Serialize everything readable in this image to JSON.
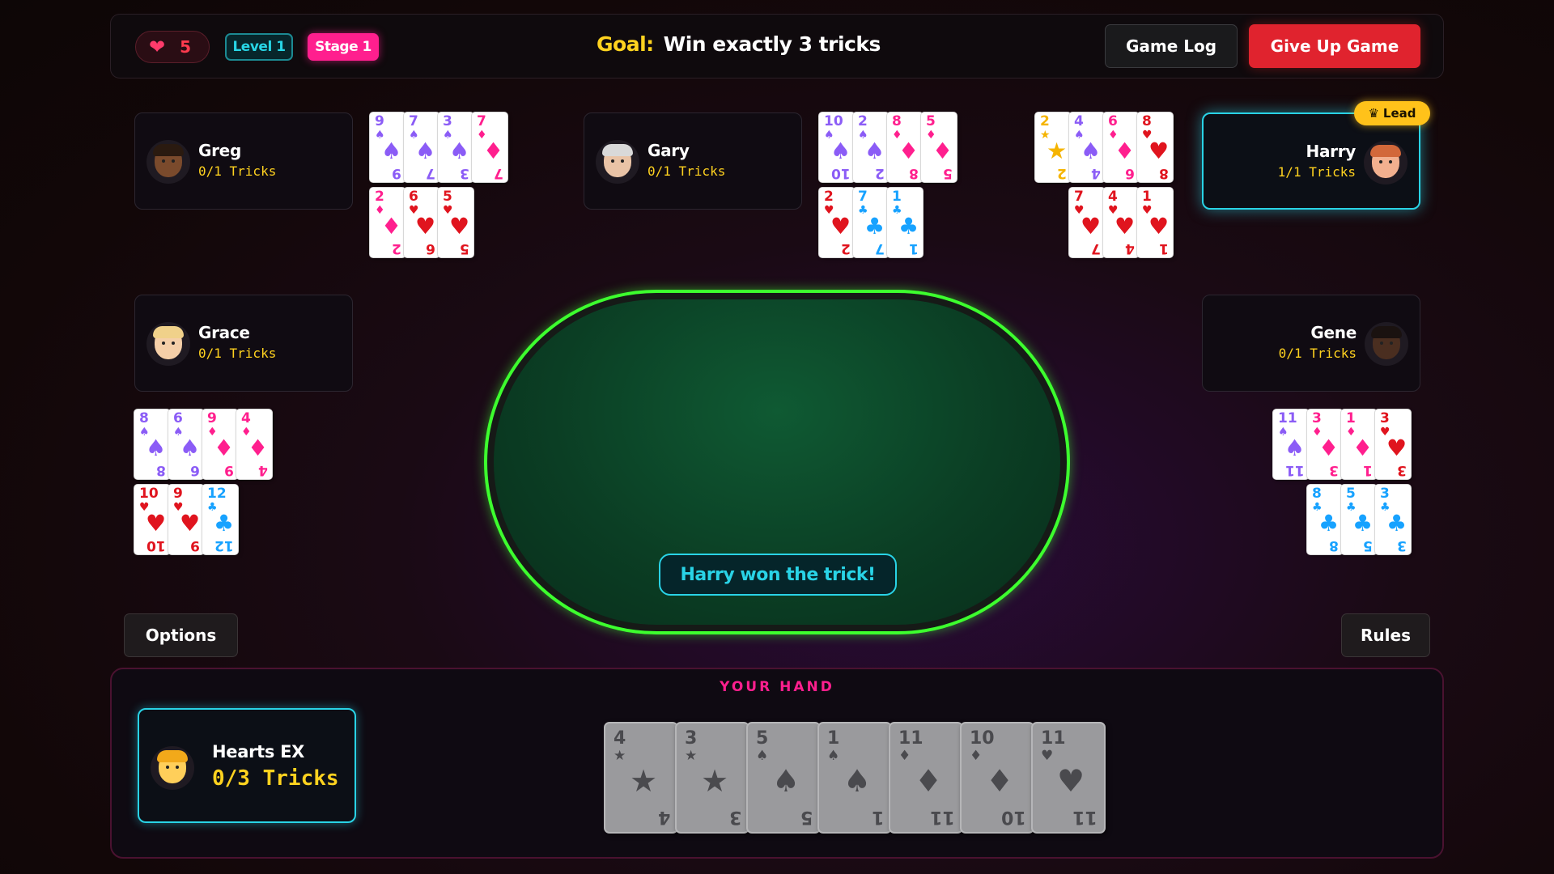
{
  "header": {
    "lives": "5",
    "level": "Level 1",
    "stage": "Stage 1",
    "goal_label": "Goal:",
    "goal_text": "Win exactly 3 tricks",
    "game_log_label": "Game Log",
    "give_up_label": "Give Up Game"
  },
  "players": {
    "greg": {
      "name": "Greg",
      "tricks": "0/1 Tricks"
    },
    "gary": {
      "name": "Gary",
      "tricks": "0/1 Tricks"
    },
    "harry": {
      "name": "Harry",
      "tricks": "1/1 Tricks",
      "badge": "Lead"
    },
    "grace": {
      "name": "Grace",
      "tricks": "0/1 Tricks"
    },
    "gene": {
      "name": "Gene",
      "tricks": "0/1 Tricks"
    }
  },
  "hands": {
    "greg": [
      {
        "rank": "9",
        "suit": "spade"
      },
      {
        "rank": "7",
        "suit": "spade"
      },
      {
        "rank": "3",
        "suit": "spade"
      },
      {
        "rank": "7",
        "suit": "diamond"
      },
      {
        "rank": "2",
        "suit": "diamond"
      },
      {
        "rank": "6",
        "suit": "heart"
      },
      {
        "rank": "5",
        "suit": "heart"
      }
    ],
    "gary": [
      {
        "rank": "10",
        "suit": "spade"
      },
      {
        "rank": "2",
        "suit": "spade"
      },
      {
        "rank": "8",
        "suit": "diamond"
      },
      {
        "rank": "5",
        "suit": "diamond"
      },
      {
        "rank": "2",
        "suit": "heart"
      },
      {
        "rank": "7",
        "suit": "club"
      },
      {
        "rank": "1",
        "suit": "club"
      }
    ],
    "harry": [
      {
        "rank": "2",
        "suit": "star"
      },
      {
        "rank": "4",
        "suit": "spade"
      },
      {
        "rank": "6",
        "suit": "diamond"
      },
      {
        "rank": "8",
        "suit": "heart"
      },
      {
        "rank": "7",
        "suit": "heart"
      },
      {
        "rank": "4",
        "suit": "heart"
      },
      {
        "rank": "1",
        "suit": "heart"
      }
    ],
    "grace": [
      {
        "rank": "8",
        "suit": "spade"
      },
      {
        "rank": "6",
        "suit": "spade"
      },
      {
        "rank": "9",
        "suit": "diamond"
      },
      {
        "rank": "4",
        "suit": "diamond"
      },
      {
        "rank": "10",
        "suit": "heart"
      },
      {
        "rank": "9",
        "suit": "heart"
      },
      {
        "rank": "12",
        "suit": "club"
      }
    ],
    "gene": [
      {
        "rank": "11",
        "suit": "spade"
      },
      {
        "rank": "3",
        "suit": "diamond"
      },
      {
        "rank": "1",
        "suit": "diamond"
      },
      {
        "rank": "3",
        "suit": "heart"
      },
      {
        "rank": "8",
        "suit": "club"
      },
      {
        "rank": "5",
        "suit": "club"
      },
      {
        "rank": "3",
        "suit": "club"
      }
    ]
  },
  "table": {
    "message": "Harry won the trick!"
  },
  "controls": {
    "options_label": "Options",
    "rules_label": "Rules"
  },
  "my_hand": {
    "title": "YOUR HAND",
    "name": "Hearts EX",
    "tricks": "0/3 Tricks",
    "cards": [
      {
        "rank": "4",
        "suit": "star"
      },
      {
        "rank": "3",
        "suit": "star"
      },
      {
        "rank": "5",
        "suit": "spade"
      },
      {
        "rank": "1",
        "suit": "spade"
      },
      {
        "rank": "11",
        "suit": "diamond"
      },
      {
        "rank": "10",
        "suit": "diamond"
      },
      {
        "rank": "11",
        "suit": "heart"
      }
    ]
  },
  "colors": {
    "spade": "#8b5cf6",
    "heart": "#e0141e",
    "diamond": "#ff1f8e",
    "club": "#17a2ff",
    "star": "#f5b400",
    "accent_cyan": "#29d3e6",
    "accent_pink": "#ff1f8e",
    "table_border": "#3dff2e",
    "gold": "#ffd21f"
  }
}
